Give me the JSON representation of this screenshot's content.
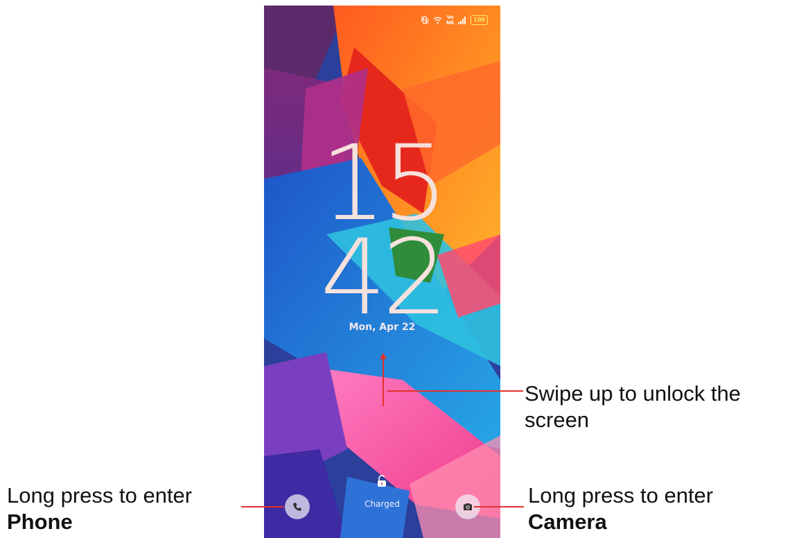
{
  "status_bar": {
    "icons": [
      "vibrate-icon",
      "wifi-icon",
      "volte-icon",
      "signal-icon",
      "battery-icon"
    ],
    "volte_top": "Vo",
    "volte_bottom": "NR",
    "battery": "100"
  },
  "lockscreen": {
    "hour": "15",
    "minute": "42",
    "date": "Mon, Apr 22",
    "charge_status": "Charged"
  },
  "callouts": {
    "swipe_line1": "Swipe up to unlock the",
    "swipe_line2": "screen",
    "phone_line1": "Long press to enter",
    "phone_line2": "Phone",
    "camera_line1": "Long press to enter",
    "camera_line2": "Camera"
  },
  "colors": {
    "annotation_accent": "#e3322b",
    "clock_color": "#f6e1dc"
  }
}
